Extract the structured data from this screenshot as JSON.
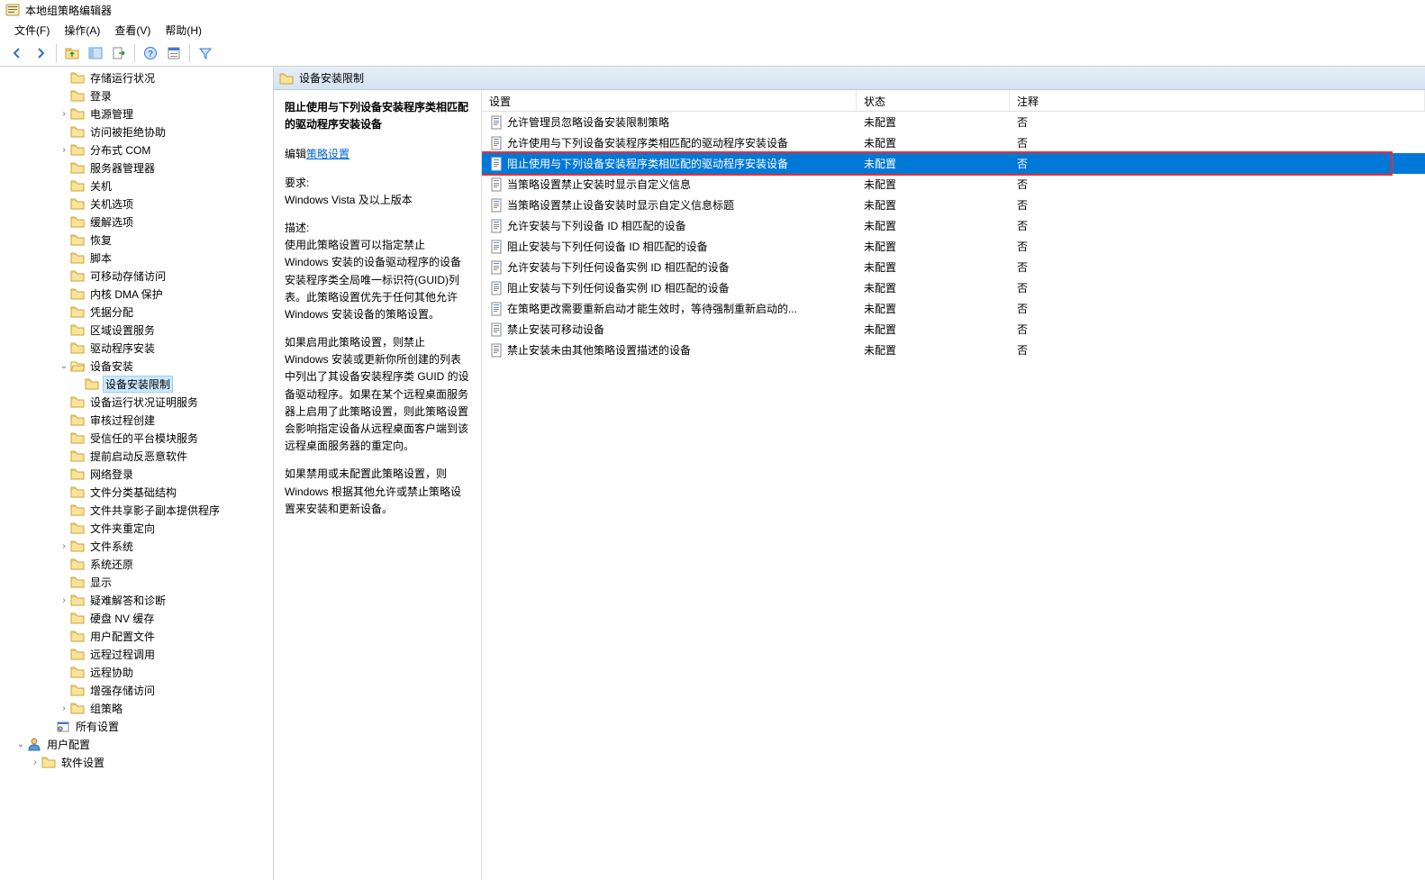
{
  "window": {
    "title": "本地组策略编辑器"
  },
  "menu": {
    "file": "文件(F)",
    "action": "操作(A)",
    "view": "查看(V)",
    "help": "帮助(H)"
  },
  "tree": {
    "items": [
      {
        "label": "存储运行状况",
        "indent": 4,
        "exp": ""
      },
      {
        "label": "登录",
        "indent": 4,
        "exp": ""
      },
      {
        "label": "电源管理",
        "indent": 4,
        "exp": ">"
      },
      {
        "label": "访问被拒绝协助",
        "indent": 4,
        "exp": ""
      },
      {
        "label": "分布式 COM",
        "indent": 4,
        "exp": ">"
      },
      {
        "label": "服务器管理器",
        "indent": 4,
        "exp": ""
      },
      {
        "label": "关机",
        "indent": 4,
        "exp": ""
      },
      {
        "label": "关机选项",
        "indent": 4,
        "exp": ""
      },
      {
        "label": "缓解选项",
        "indent": 4,
        "exp": ""
      },
      {
        "label": "恢复",
        "indent": 4,
        "exp": ""
      },
      {
        "label": "脚本",
        "indent": 4,
        "exp": ""
      },
      {
        "label": "可移动存储访问",
        "indent": 4,
        "exp": ""
      },
      {
        "label": "内核 DMA 保护",
        "indent": 4,
        "exp": ""
      },
      {
        "label": "凭据分配",
        "indent": 4,
        "exp": ""
      },
      {
        "label": "区域设置服务",
        "indent": 4,
        "exp": ""
      },
      {
        "label": "驱动程序安装",
        "indent": 4,
        "exp": ""
      },
      {
        "label": "设备安装",
        "indent": 4,
        "exp": "v",
        "expanded": true
      },
      {
        "label": "设备安装限制",
        "indent": 5,
        "exp": "",
        "selected": true
      },
      {
        "label": "设备运行状况证明服务",
        "indent": 4,
        "exp": ""
      },
      {
        "label": "审核过程创建",
        "indent": 4,
        "exp": ""
      },
      {
        "label": "受信任的平台模块服务",
        "indent": 4,
        "exp": ""
      },
      {
        "label": "提前启动反恶意软件",
        "indent": 4,
        "exp": ""
      },
      {
        "label": "网络登录",
        "indent": 4,
        "exp": ""
      },
      {
        "label": "文件分类基础结构",
        "indent": 4,
        "exp": ""
      },
      {
        "label": "文件共享影子副本提供程序",
        "indent": 4,
        "exp": ""
      },
      {
        "label": "文件夹重定向",
        "indent": 4,
        "exp": ""
      },
      {
        "label": "文件系统",
        "indent": 4,
        "exp": ">"
      },
      {
        "label": "系统还原",
        "indent": 4,
        "exp": ""
      },
      {
        "label": "显示",
        "indent": 4,
        "exp": ""
      },
      {
        "label": "疑难解答和诊断",
        "indent": 4,
        "exp": ">"
      },
      {
        "label": "硬盘 NV 缓存",
        "indent": 4,
        "exp": ""
      },
      {
        "label": "用户配置文件",
        "indent": 4,
        "exp": ""
      },
      {
        "label": "远程过程调用",
        "indent": 4,
        "exp": ""
      },
      {
        "label": "远程协助",
        "indent": 4,
        "exp": ""
      },
      {
        "label": "增强存储访问",
        "indent": 4,
        "exp": ""
      },
      {
        "label": "组策略",
        "indent": 4,
        "exp": ">"
      },
      {
        "label": "所有设置",
        "indent": 3,
        "exp": "",
        "icon": "gear"
      },
      {
        "label": "用户配置",
        "indent": 1,
        "exp": "v",
        "icon": "user",
        "expanded": true
      },
      {
        "label": "软件设置",
        "indent": 2,
        "exp": ">"
      }
    ]
  },
  "category": {
    "title": "设备安装限制"
  },
  "desc": {
    "title": "阻止使用与下列设备安装程序类相匹配的驱动程序安装设备",
    "edit_prefix": "编辑",
    "edit_link": "策略设置",
    "req_label": "要求:",
    "req_value": "Windows Vista 及以上版本",
    "desc_label": "描述:",
    "p1": "使用此策略设置可以指定禁止 Windows 安装的设备驱动程序的设备安装程序类全局唯一标识符(GUID)列表。此策略设置优先于任何其他允许 Windows 安装设备的策略设置。",
    "p2": "如果启用此策略设置，则禁止 Windows 安装或更新你所创建的列表中列出了其设备安装程序类 GUID 的设备驱动程序。如果在某个远程桌面服务器上启用了此策略设置，则此策略设置会影响指定设备从远程桌面客户端到该远程桌面服务器的重定向。",
    "p3": "如果禁用或未配置此策略设置，则 Windows 根据其他允许或禁止策略设置来安装和更新设备。"
  },
  "list": {
    "columns": {
      "setting": "设置",
      "state": "状态",
      "note": "注释"
    },
    "rows": [
      {
        "setting": "允许管理员忽略设备安装限制策略",
        "state": "未配置",
        "note": "否"
      },
      {
        "setting": "允许使用与下列设备安装程序类相匹配的驱动程序安装设备",
        "state": "未配置",
        "note": "否"
      },
      {
        "setting": "阻止使用与下列设备安装程序类相匹配的驱动程序安装设备",
        "state": "未配置",
        "note": "否",
        "selected": true,
        "highlight": true
      },
      {
        "setting": "当策略设置禁止安装时显示自定义信息",
        "state": "未配置",
        "note": "否"
      },
      {
        "setting": "当策略设置禁止设备安装时显示自定义信息标题",
        "state": "未配置",
        "note": "否"
      },
      {
        "setting": "允许安装与下列设备 ID 相匹配的设备",
        "state": "未配置",
        "note": "否"
      },
      {
        "setting": "阻止安装与下列任何设备 ID 相匹配的设备",
        "state": "未配置",
        "note": "否"
      },
      {
        "setting": "允许安装与下列任何设备实例 ID 相匹配的设备",
        "state": "未配置",
        "note": "否"
      },
      {
        "setting": "阻止安装与下列任何设备实例 ID 相匹配的设备",
        "state": "未配置",
        "note": "否"
      },
      {
        "setting": "在策略更改需要重新启动才能生效时，等待强制重新启动的...",
        "state": "未配置",
        "note": "否"
      },
      {
        "setting": "禁止安装可移动设备",
        "state": "未配置",
        "note": "否"
      },
      {
        "setting": "禁止安装未由其他策略设置描述的设备",
        "state": "未配置",
        "note": "否"
      }
    ]
  }
}
